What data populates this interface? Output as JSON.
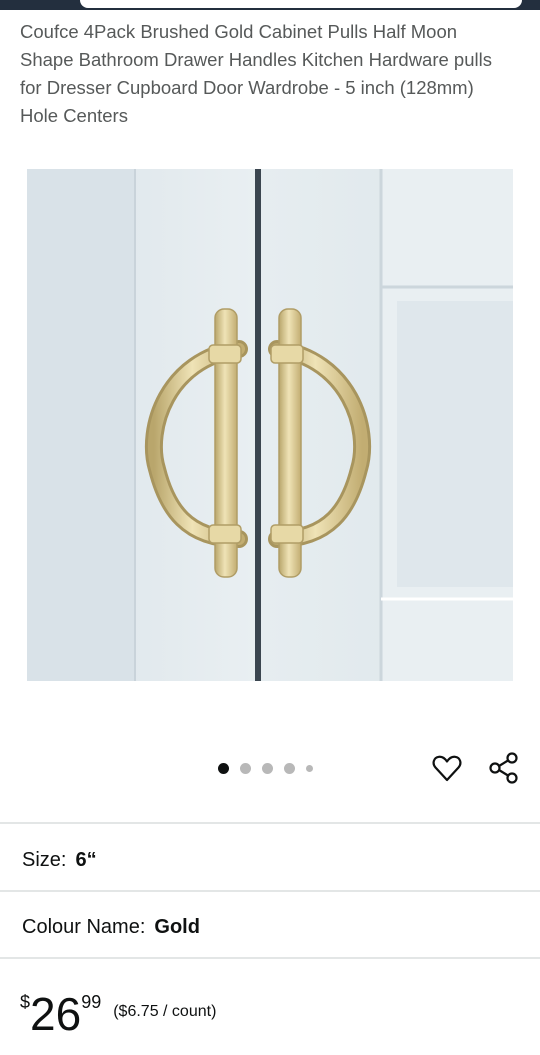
{
  "product": {
    "title": "Coufce 4Pack Brushed Gold Cabinet Pulls Half Moon Shape Bathroom Drawer Handles Kitchen Hardware pulls for Dresser Cupboard Door Wardrobe - 5 inch (128mm) Hole Centers",
    "image_alt": "Brushed gold half moon cabinet pulls on white cabinet doors"
  },
  "carousel": {
    "total": 5,
    "active": 1
  },
  "variations": {
    "size": {
      "label": "Size:",
      "value": "6“"
    },
    "colour": {
      "label": "Colour Name:",
      "value": "Gold"
    }
  },
  "price": {
    "symbol": "$",
    "whole": "26",
    "fraction": "99",
    "per_unit": "($6.75 / count)"
  },
  "colors": {
    "gold": "#d6c48e",
    "door": "#e4ebef",
    "text_muted": "#565959"
  }
}
